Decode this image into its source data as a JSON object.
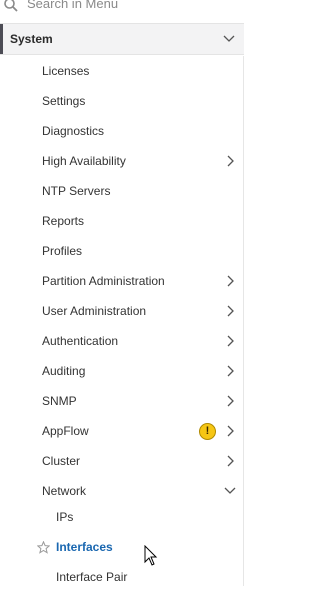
{
  "search": {
    "placeholder": "Search in Menu",
    "icon": "search-icon"
  },
  "section": {
    "label": "System",
    "expanded": true,
    "chevron": "chevron-down-icon"
  },
  "menu": {
    "items": [
      {
        "label": "Licenses",
        "has_children": false
      },
      {
        "label": "Settings",
        "has_children": false
      },
      {
        "label": "Diagnostics",
        "has_children": false
      },
      {
        "label": "High Availability",
        "has_children": true
      },
      {
        "label": "NTP Servers",
        "has_children": false
      },
      {
        "label": "Reports",
        "has_children": false
      },
      {
        "label": "Profiles",
        "has_children": false
      },
      {
        "label": "Partition Administration",
        "has_children": true
      },
      {
        "label": "User Administration",
        "has_children": true
      },
      {
        "label": "Authentication",
        "has_children": true
      },
      {
        "label": "Auditing",
        "has_children": true
      },
      {
        "label": "SNMP",
        "has_children": true
      },
      {
        "label": "AppFlow",
        "has_children": true,
        "warning": "!"
      },
      {
        "label": "Cluster",
        "has_children": true
      },
      {
        "label": "Network",
        "has_children": true,
        "expanded": true
      }
    ],
    "network_children": [
      {
        "label": "IPs",
        "active": false
      },
      {
        "label": "Interfaces",
        "active": true,
        "favorite_icon": "star-outline-icon"
      },
      {
        "label": "Interface Pair",
        "active": false
      }
    ]
  },
  "colors": {
    "active_link": "#1a67b0",
    "section_bg": "#f3f3f4",
    "warning": "#f6c614",
    "text": "#333333"
  }
}
